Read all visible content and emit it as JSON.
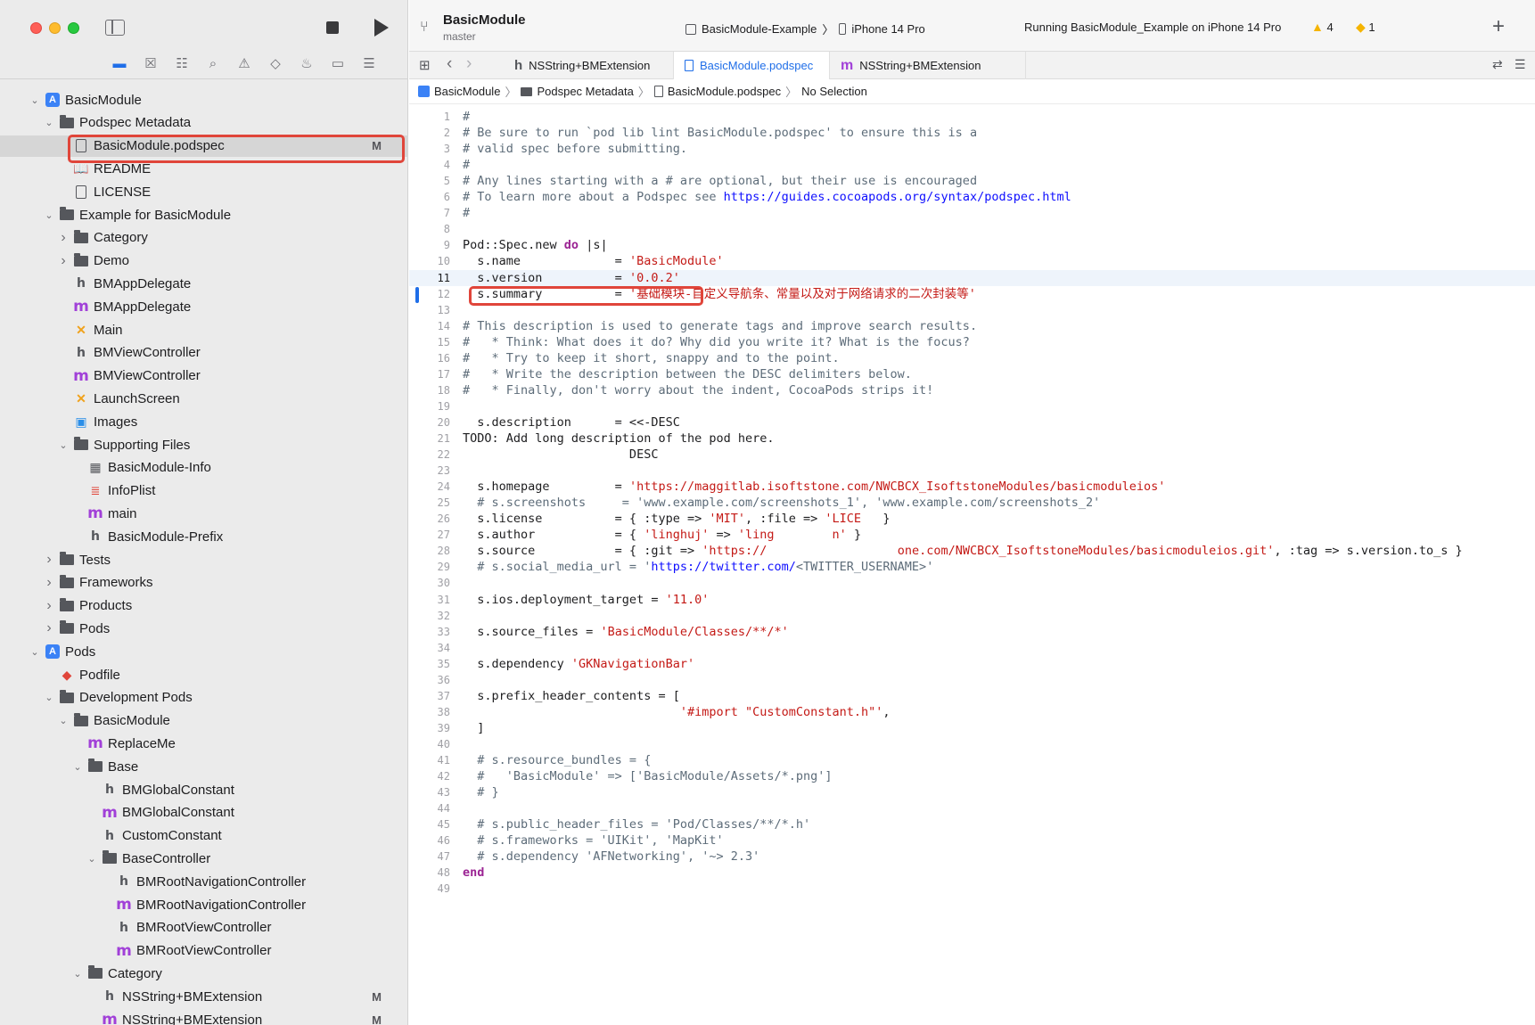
{
  "toolbar": {
    "project_name": "BasicModule",
    "branch": "master",
    "scheme": "BasicModule-Example",
    "device": "iPhone 14 Pro",
    "status": "Running BasicModule_Example on iPhone 14 Pro",
    "warnings": "4",
    "issues": "1",
    "add_symbol": "+"
  },
  "nav_tabs": [
    "folder-icon",
    "source-control-icon",
    "symbol-icon",
    "find-icon",
    "issue-icon",
    "test-icon",
    "debug-icon",
    "breakpoint-icon",
    "report-icon"
  ],
  "tree": [
    {
      "label": "BasicModule",
      "depth": 0,
      "kind": "project",
      "chev": "v"
    },
    {
      "label": "Podspec Metadata",
      "depth": 1,
      "kind": "folder",
      "chev": "v"
    },
    {
      "label": "BasicModule.podspec",
      "depth": 2,
      "kind": "doc",
      "chev": "",
      "status": "M",
      "selected": true
    },
    {
      "label": "README",
      "depth": 2,
      "kind": "book",
      "chev": ""
    },
    {
      "label": "LICENSE",
      "depth": 2,
      "kind": "doc",
      "chev": ""
    },
    {
      "label": "Example for BasicModule",
      "depth": 1,
      "kind": "folder",
      "chev": "v"
    },
    {
      "label": "Category",
      "depth": 2,
      "kind": "folder",
      "chev": ">"
    },
    {
      "label": "Demo",
      "depth": 2,
      "kind": "folder",
      "chev": ">"
    },
    {
      "label": "BMAppDelegate",
      "depth": 2,
      "kind": "h",
      "chev": ""
    },
    {
      "label": "BMAppDelegate",
      "depth": 2,
      "kind": "m",
      "chev": ""
    },
    {
      "label": "Main",
      "depth": 2,
      "kind": "x",
      "chev": ""
    },
    {
      "label": "BMViewController",
      "depth": 2,
      "kind": "h",
      "chev": ""
    },
    {
      "label": "BMViewController",
      "depth": 2,
      "kind": "m",
      "chev": ""
    },
    {
      "label": "LaunchScreen",
      "depth": 2,
      "kind": "x",
      "chev": ""
    },
    {
      "label": "Images",
      "depth": 2,
      "kind": "img",
      "chev": ""
    },
    {
      "label": "Supporting Files",
      "depth": 2,
      "kind": "folder",
      "chev": "v"
    },
    {
      "label": "BasicModule-Info",
      "depth": 3,
      "kind": "grid",
      "chev": ""
    },
    {
      "label": "InfoPlist",
      "depth": 3,
      "kind": "plist",
      "chev": ""
    },
    {
      "label": "main",
      "depth": 3,
      "kind": "m",
      "chev": ""
    },
    {
      "label": "BasicModule-Prefix",
      "depth": 3,
      "kind": "h",
      "chev": ""
    },
    {
      "label": "Tests",
      "depth": 1,
      "kind": "folder",
      "chev": ">"
    },
    {
      "label": "Frameworks",
      "depth": 1,
      "kind": "folder",
      "chev": ">"
    },
    {
      "label": "Products",
      "depth": 1,
      "kind": "folder",
      "chev": ">"
    },
    {
      "label": "Pods",
      "depth": 1,
      "kind": "folder",
      "chev": ">"
    },
    {
      "label": "Pods",
      "depth": 0,
      "kind": "project",
      "chev": "v"
    },
    {
      "label": "Podfile",
      "depth": 1,
      "kind": "ruby",
      "chev": ""
    },
    {
      "label": "Development Pods",
      "depth": 1,
      "kind": "folder",
      "chev": "v"
    },
    {
      "label": "BasicModule",
      "depth": 2,
      "kind": "folder",
      "chev": "v"
    },
    {
      "label": "ReplaceMe",
      "depth": 3,
      "kind": "m",
      "chev": ""
    },
    {
      "label": "Base",
      "depth": 3,
      "kind": "folder",
      "chev": "v"
    },
    {
      "label": "BMGlobalConstant",
      "depth": 4,
      "kind": "h",
      "chev": ""
    },
    {
      "label": "BMGlobalConstant",
      "depth": 4,
      "kind": "m",
      "chev": ""
    },
    {
      "label": "CustomConstant",
      "depth": 4,
      "kind": "h",
      "chev": ""
    },
    {
      "label": "BaseController",
      "depth": 4,
      "kind": "folder",
      "chev": "v"
    },
    {
      "label": "BMRootNavigationController",
      "depth": 5,
      "kind": "h",
      "chev": ""
    },
    {
      "label": "BMRootNavigationController",
      "depth": 5,
      "kind": "m",
      "chev": ""
    },
    {
      "label": "BMRootViewController",
      "depth": 5,
      "kind": "h",
      "chev": ""
    },
    {
      "label": "BMRootViewController",
      "depth": 5,
      "kind": "m",
      "chev": ""
    },
    {
      "label": "Category",
      "depth": 3,
      "kind": "folder",
      "chev": "v"
    },
    {
      "label": "NSString+BMExtension",
      "depth": 4,
      "kind": "h",
      "chev": "",
      "status": "M"
    },
    {
      "label": "NSString+BMExtension",
      "depth": 4,
      "kind": "m",
      "chev": "",
      "status": "M"
    }
  ],
  "tabs": [
    {
      "label": "NSString+BMExtension",
      "kind": "h"
    },
    {
      "label": "BasicModule.podspec",
      "kind": "doc"
    },
    {
      "label": "NSString+BMExtension",
      "kind": "m"
    }
  ],
  "jumpbar": [
    "BasicModule",
    "Podspec Metadata",
    "BasicModule.podspec",
    "No Selection"
  ],
  "current_line": 11,
  "code": [
    [
      [
        "cm",
        "#"
      ]
    ],
    [
      [
        "cm",
        "# Be sure to run `pod lib lint BasicModule.podspec' to ensure this is a"
      ]
    ],
    [
      [
        "cm",
        "# valid spec before submitting."
      ]
    ],
    [
      [
        "cm",
        "#"
      ]
    ],
    [
      [
        "cm",
        "# Any lines starting with a # are optional, but their use is encouraged"
      ]
    ],
    [
      [
        "cm",
        "# To learn more about a Podspec see "
      ],
      [
        "url",
        "https://guides.cocoapods.org/syntax/podspec.html"
      ]
    ],
    [
      [
        "cm",
        "#"
      ]
    ],
    [
      [
        "",
        ""
      ]
    ],
    [
      [
        "",
        "Pod::Spec.new "
      ],
      [
        "kw",
        "do"
      ],
      [
        "",
        " |s|"
      ]
    ],
    [
      [
        "",
        "  s.name             = "
      ],
      [
        "str",
        "'BasicModule'"
      ]
    ],
    [
      [
        "",
        "  s.version          = "
      ],
      [
        "str",
        "'0.0.2'"
      ]
    ],
    [
      [
        "",
        "  s.summary          = "
      ],
      [
        "str",
        "'基础模块-自定义导航条、常量以及对于网络请求的二次封装等'"
      ]
    ],
    [
      [
        "",
        ""
      ]
    ],
    [
      [
        "cm",
        "# This description is used to generate tags and improve search results."
      ]
    ],
    [
      [
        "cm",
        "#   * Think: What does it do? Why did you write it? What is the focus?"
      ]
    ],
    [
      [
        "cm",
        "#   * Try to keep it short, snappy and to the point."
      ]
    ],
    [
      [
        "cm",
        "#   * Write the description between the DESC delimiters below."
      ]
    ],
    [
      [
        "cm",
        "#   * Finally, don't worry about the indent, CocoaPods strips it!"
      ]
    ],
    [
      [
        "",
        ""
      ]
    ],
    [
      [
        "",
        "  s.description      = <<-DESC"
      ]
    ],
    [
      [
        "",
        "TODO: Add long description of the pod here."
      ]
    ],
    [
      [
        "",
        "                       DESC"
      ]
    ],
    [
      [
        "",
        ""
      ]
    ],
    [
      [
        "",
        "  s.homepage         = "
      ],
      [
        "str",
        "'https://maggitlab.isoftstone.com/NWCBCX_IsoftstoneModules/basicmoduleios'"
      ]
    ],
    [
      [
        "cm",
        "  # s.screenshots     = 'www.example.com/screenshots_1', 'www.example.com/screenshots_2'"
      ]
    ],
    [
      [
        "",
        "  s.license          = { :type => "
      ],
      [
        "str",
        "'MIT'"
      ],
      [
        "",
        ", :file => "
      ],
      [
        "str",
        "'LICE"
      ],
      [
        "",
        "   }"
      ]
    ],
    [
      [
        "",
        "  s.author           = { "
      ],
      [
        "str",
        "'linghuj'"
      ],
      [
        "",
        " => "
      ],
      [
        "str",
        "'ling"
      ],
      [
        "",
        "        "
      ],
      [
        "str",
        "n'"
      ],
      [
        "",
        " }"
      ]
    ],
    [
      [
        "",
        "  s.source           = { :git => "
      ],
      [
        "str",
        "'https://"
      ],
      [
        "",
        "                  "
      ],
      [
        "str",
        "one.com/NWCBCX_IsoftstoneModules/basicmoduleios.git'"
      ],
      [
        "",
        ", :tag => s.version.to_s }"
      ]
    ],
    [
      [
        "cm",
        "  # s.social_media_url = '"
      ],
      [
        "url",
        "https://twitter.com/"
      ],
      [
        "cm",
        "<TWITTER_USERNAME>'"
      ]
    ],
    [
      [
        "",
        ""
      ]
    ],
    [
      [
        "",
        "  s.ios.deployment_target = "
      ],
      [
        "str",
        "'11.0'"
      ]
    ],
    [
      [
        "",
        ""
      ]
    ],
    [
      [
        "",
        "  s.source_files = "
      ],
      [
        "str",
        "'BasicModule/Classes/**/*'"
      ]
    ],
    [
      [
        "",
        ""
      ]
    ],
    [
      [
        "",
        "  s.dependency "
      ],
      [
        "str",
        "'GKNavigationBar'"
      ]
    ],
    [
      [
        "",
        ""
      ]
    ],
    [
      [
        "",
        "  s.prefix_header_contents = ["
      ]
    ],
    [
      [
        "",
        "                              "
      ],
      [
        "str",
        "'#import \"CustomConstant.h\"'"
      ],
      [
        "",
        ","
      ]
    ],
    [
      [
        "",
        "  ]"
      ]
    ],
    [
      [
        "",
        ""
      ]
    ],
    [
      [
        "cm",
        "  # s.resource_bundles = {"
      ]
    ],
    [
      [
        "cm",
        "  #   'BasicModule' => ['BasicModule/Assets/*.png']"
      ]
    ],
    [
      [
        "cm",
        "  # }"
      ]
    ],
    [
      [
        "",
        ""
      ]
    ],
    [
      [
        "cm",
        "  # s.public_header_files = 'Pod/Classes/**/*.h'"
      ]
    ],
    [
      [
        "cm",
        "  # s.frameworks = 'UIKit', 'MapKit'"
      ]
    ],
    [
      [
        "cm",
        "  # s.dependency 'AFNetworking', '~> 2.3'"
      ]
    ],
    [
      [
        "kw",
        "end"
      ]
    ],
    [
      [
        "",
        ""
      ]
    ]
  ]
}
